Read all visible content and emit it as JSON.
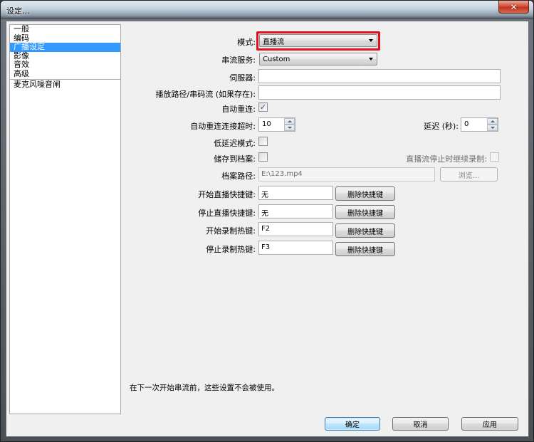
{
  "window": {
    "title": "设定...",
    "close_icon": "close-icon"
  },
  "sidebar": {
    "items": [
      {
        "label": "一般",
        "selected": false
      },
      {
        "label": "编码",
        "selected": false
      },
      {
        "label": "广播设定",
        "selected": true
      },
      {
        "label": "影像",
        "selected": false
      },
      {
        "label": "音效",
        "selected": false
      },
      {
        "label": "高级",
        "selected": false
      }
    ],
    "plugins": [
      {
        "label": "麦克风噪音闸"
      }
    ]
  },
  "form": {
    "mode": {
      "label": "模式:",
      "value": "直播流"
    },
    "service": {
      "label": "串流服务:",
      "value": "Custom"
    },
    "server": {
      "label": "伺服器:",
      "value": ""
    },
    "playpath": {
      "label": "播放路径/串码流 (如果存在):",
      "value": ""
    },
    "auto_reconnect": {
      "label": "自动重连:",
      "checked": true
    },
    "reconnect_timeout": {
      "label": "自动重连连接超时:",
      "value": "10"
    },
    "delay": {
      "label": "延迟 (秒):",
      "value": "0"
    },
    "low_latency": {
      "label": "低延迟模式:",
      "checked": false
    },
    "save_to_file": {
      "label": "储存到档案:",
      "checked": false
    },
    "keep_recording": {
      "label": "直播流停止时继续录制:",
      "checked": false
    },
    "file_path": {
      "label": "档案路径:",
      "value": "E:\\123.mp4",
      "browse_label": "浏览..."
    },
    "hotkeys": [
      {
        "label": "开始直播快捷键:",
        "value": "无",
        "clear_label": "删除快捷键"
      },
      {
        "label": "停止直播快捷键:",
        "value": "无",
        "clear_label": "删除快捷键"
      },
      {
        "label": "开始录制热键:",
        "value": "F2",
        "clear_label": "删除快捷键"
      },
      {
        "label": "停止录制热键:",
        "value": "F3",
        "clear_label": "删除快捷键"
      }
    ],
    "note": "在下一次开始串流前，这些设置不会被使用。"
  },
  "footer": {
    "ok_label": "确定",
    "cancel_label": "取消",
    "apply_label": "应用"
  },
  "colors": {
    "selection": "#3399ff",
    "highlight_border": "#e2101a",
    "close_button": "#c7432b"
  }
}
